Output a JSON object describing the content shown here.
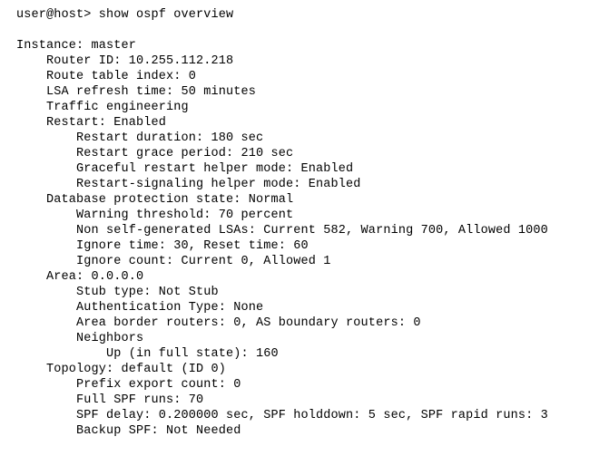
{
  "terminal": {
    "app": "terminal-session",
    "background_color": "#ffffff",
    "foreground_color": "#000000",
    "prompt": "user@host>",
    "command": "show ospf overview",
    "prompt_line": "user@host> show ospf overview",
    "lines": [
      "user@host> show ospf overview",
      "",
      "Instance: master",
      "    Router ID: 10.255.112.218",
      "    Route table index: 0",
      "    LSA refresh time: 50 minutes",
      "    Traffic engineering",
      "    Restart: Enabled",
      "        Restart duration: 180 sec",
      "        Restart grace period: 210 sec",
      "        Graceful restart helper mode: Enabled",
      "        Restart-signaling helper mode: Enabled",
      "    Database protection state: Normal",
      "        Warning threshold: 70 percent",
      "        Non self-generated LSAs: Current 582, Warning 700, Allowed 1000",
      "        Ignore time: 30, Reset time: 60",
      "        Ignore count: Current 0, Allowed 1",
      "    Area: 0.0.0.0",
      "        Stub type: Not Stub",
      "        Authentication Type: None",
      "        Area border routers: 0, AS boundary routers: 0",
      "        Neighbors",
      "            Up (in full state): 160",
      "    Topology: default (ID 0)",
      "        Prefix export count: 0",
      "        Full SPF runs: 70",
      "        SPF delay: 0.200000 sec, SPF holddown: 5 sec, SPF rapid runs: 3",
      "        Backup SPF: Not Needed"
    ],
    "fields": {
      "instance": "master",
      "router_id": "10.255.112.218",
      "route_table_index": "0",
      "lsa_refresh_time": "50 minutes",
      "traffic_engineering": "Traffic engineering",
      "restart": "Enabled",
      "restart_duration": "180 sec",
      "restart_grace_period": "210 sec",
      "graceful_restart_helper_mode": "Enabled",
      "restart_signaling_helper_mode": "Enabled",
      "database_protection_state": "Normal",
      "warning_threshold": "70 percent",
      "non_self_generated_lsas_current": "582",
      "non_self_generated_lsas_warning": "700",
      "non_self_generated_lsas_allowed": "1000",
      "ignore_time": "30",
      "reset_time": "60",
      "ignore_count_current": "0",
      "ignore_count_allowed": "1",
      "area": "0.0.0.0",
      "stub_type": "Not Stub",
      "authentication_type": "None",
      "area_border_routers": "0",
      "as_boundary_routers": "0",
      "neighbors_up_full_state": "160",
      "topology": "default (ID 0)",
      "prefix_export_count": "0",
      "full_spf_runs": "70",
      "spf_delay": "0.200000 sec",
      "spf_holddown": "5 sec",
      "spf_rapid_runs": "3",
      "backup_spf": "Not Needed"
    }
  }
}
